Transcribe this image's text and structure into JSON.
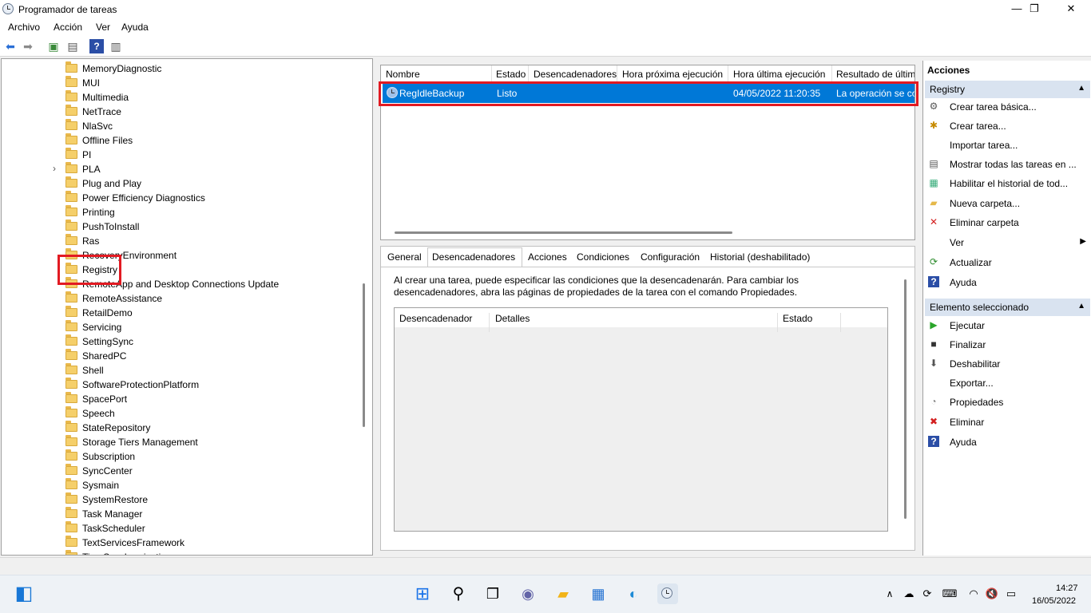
{
  "window": {
    "title": "Programador de tareas",
    "minimize": "—",
    "maximize": "❐",
    "close": "✕"
  },
  "menu": [
    "Archivo",
    "Acción",
    "Ver",
    "Ayuda"
  ],
  "tree": {
    "items": [
      {
        "label": "MemoryDiagnostic"
      },
      {
        "label": "MUI"
      },
      {
        "label": "Multimedia"
      },
      {
        "label": "NetTrace"
      },
      {
        "label": "NlaSvc"
      },
      {
        "label": "Offline Files"
      },
      {
        "label": "PI"
      },
      {
        "label": "PLA",
        "expandable": true
      },
      {
        "label": "Plug and Play"
      },
      {
        "label": "Power Efficiency Diagnostics"
      },
      {
        "label": "Printing"
      },
      {
        "label": "PushToInstall"
      },
      {
        "label": "Ras"
      },
      {
        "label": "RecoveryEnvironment"
      },
      {
        "label": "Registry",
        "selected": true
      },
      {
        "label": "RemoteApp and Desktop Connections Update"
      },
      {
        "label": "RemoteAssistance"
      },
      {
        "label": "RetailDemo"
      },
      {
        "label": "Servicing"
      },
      {
        "label": "SettingSync"
      },
      {
        "label": "SharedPC"
      },
      {
        "label": "Shell"
      },
      {
        "label": "SoftwareProtectionPlatform"
      },
      {
        "label": "SpacePort"
      },
      {
        "label": "Speech"
      },
      {
        "label": "StateRepository"
      },
      {
        "label": "Storage Tiers Management"
      },
      {
        "label": "Subscription"
      },
      {
        "label": "SyncCenter"
      },
      {
        "label": "Sysmain"
      },
      {
        "label": "SystemRestore"
      },
      {
        "label": "Task Manager"
      },
      {
        "label": "TaskScheduler"
      },
      {
        "label": "TextServicesFramework"
      },
      {
        "label": "TimeSynchronization"
      }
    ]
  },
  "tasklist": {
    "columns": [
      "Nombre",
      "Estado",
      "Desencadenadores",
      "Hora próxima ejecución",
      "Hora última ejecución",
      "Resultado de últim"
    ],
    "row": {
      "name": "RegIdleBackup",
      "status": "Listo",
      "triggers": "",
      "next": "",
      "last": "04/05/2022 11:20:35",
      "result": "La operación se co"
    }
  },
  "details": {
    "tabs": [
      "General",
      "Desencadenadores",
      "Acciones",
      "Condiciones",
      "Configuración",
      "Historial (deshabilitado)"
    ],
    "active_tab": "Desencadenadores",
    "description": "Al crear una tarea, puede especificar las condiciones que la desencadenarán. Para cambiar los desencadenadores, abra las páginas de propiedades de la tarea con el comando Propiedades.",
    "trigger_columns": [
      "Desencadenador",
      "Detalles",
      "Estado"
    ]
  },
  "actions": {
    "title": "Acciones",
    "section1": {
      "title": "Registry",
      "items": [
        "Crear tarea básica...",
        "Crear tarea...",
        "Importar tarea...",
        "Mostrar todas las tareas en ...",
        "Habilitar el historial de tod...",
        "Nueva carpeta...",
        "Eliminar carpeta",
        "Ver",
        "Actualizar",
        "Ayuda"
      ]
    },
    "section2": {
      "title": "Elemento seleccionado",
      "items": [
        "Ejecutar",
        "Finalizar",
        "Deshabilitar",
        "Exportar...",
        "Propiedades",
        "Eliminar",
        "Ayuda"
      ]
    }
  },
  "taskbar": {
    "time": "14:27",
    "date": "16/05/2022"
  },
  "colors": {
    "selection": "#0078d7",
    "highlight_box": "#e21a22"
  }
}
